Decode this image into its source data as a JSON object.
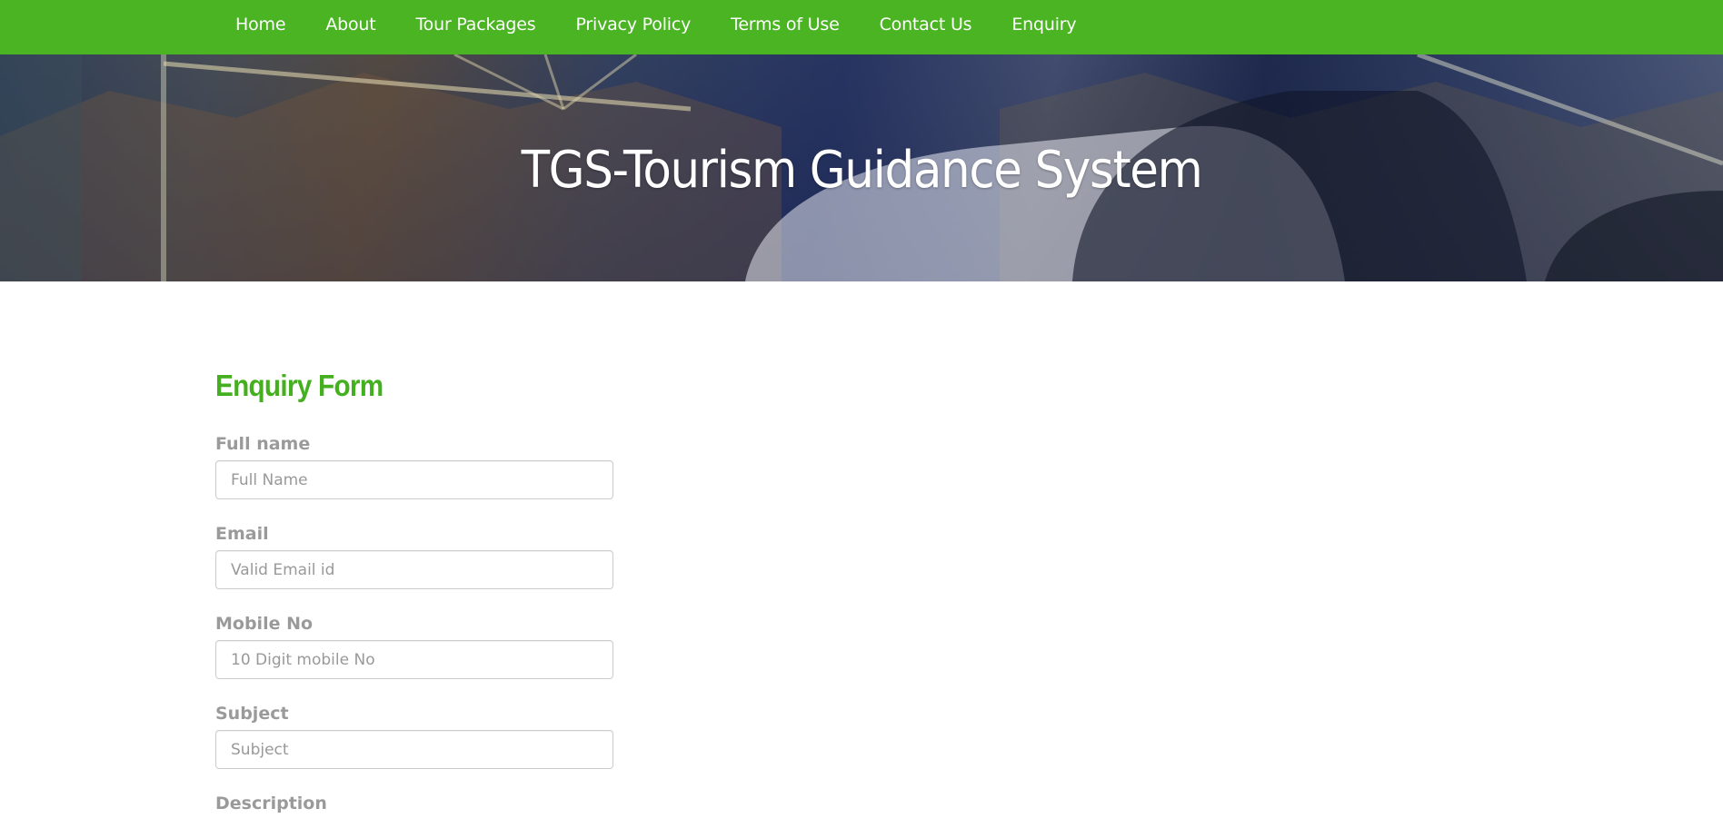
{
  "nav": {
    "items": [
      {
        "label": "Home"
      },
      {
        "label": "About"
      },
      {
        "label": "Tour Packages"
      },
      {
        "label": "Privacy Policy"
      },
      {
        "label": "Terms of Use"
      },
      {
        "label": "Contact Us"
      },
      {
        "label": "Enquiry"
      }
    ],
    "background_color": "#4ab422"
  },
  "hero": {
    "title": "TGS-Tourism Guidance System"
  },
  "form": {
    "heading": "Enquiry Form",
    "heading_color": "#45b01f",
    "fields": [
      {
        "label": "Full name",
        "placeholder": "Full Name",
        "value": ""
      },
      {
        "label": "Email",
        "placeholder": "Valid Email id",
        "value": ""
      },
      {
        "label": "Mobile No",
        "placeholder": "10 Digit mobile No",
        "value": ""
      },
      {
        "label": "Subject",
        "placeholder": "Subject",
        "value": ""
      }
    ],
    "description_label": "Description"
  }
}
